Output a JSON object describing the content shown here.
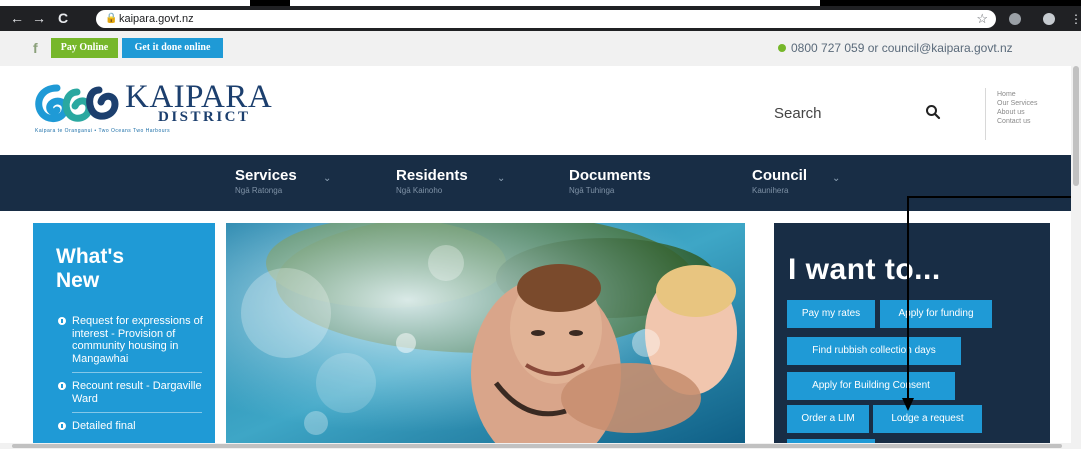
{
  "browser": {
    "url": "kaipara.govt.nz"
  },
  "utility": {
    "pay_online": "Pay Online",
    "get_it_done": "Get it done online",
    "contact": "0800 727 059 or council@kaipara.govt.nz",
    "facebook_glyph": "f"
  },
  "header": {
    "logo_title": "KAIPARA",
    "logo_subtitle": "DISTRICT",
    "logo_tagline": "Kaipara te Oranganui • Two Oceans Two Harbours",
    "search_label": "Search",
    "quick_links": [
      "Home",
      "Our Services",
      "About us",
      "Contact us"
    ]
  },
  "nav": {
    "items": [
      {
        "title": "Services",
        "maori": "Ngā Ratonga"
      },
      {
        "title": "Residents",
        "maori": "Ngā Kainoho"
      },
      {
        "title": "Documents",
        "maori": "Ngā Tuhinga"
      },
      {
        "title": "Council",
        "maori": "Kaunihera"
      }
    ]
  },
  "whats_new": {
    "heading_line1": "What's",
    "heading_line2": "New",
    "items": [
      "Request for expressions of interest - Provision of community housing in Mangawhai",
      "Recount result - Dargaville Ward",
      "Detailed final"
    ]
  },
  "i_want_to": {
    "heading": "I want to...",
    "buttons": {
      "pay_rates": "Pay my rates",
      "apply_funding": "Apply for funding",
      "find_rubbish": "Find rubbish collection days",
      "building_consent": "Apply for Building Consent",
      "order_lim": "Order a LIM",
      "lodge_request": "Lodge a request"
    }
  },
  "colors": {
    "navy": "#182d45",
    "blue": "#1f9ad6",
    "green": "#76b72a"
  }
}
